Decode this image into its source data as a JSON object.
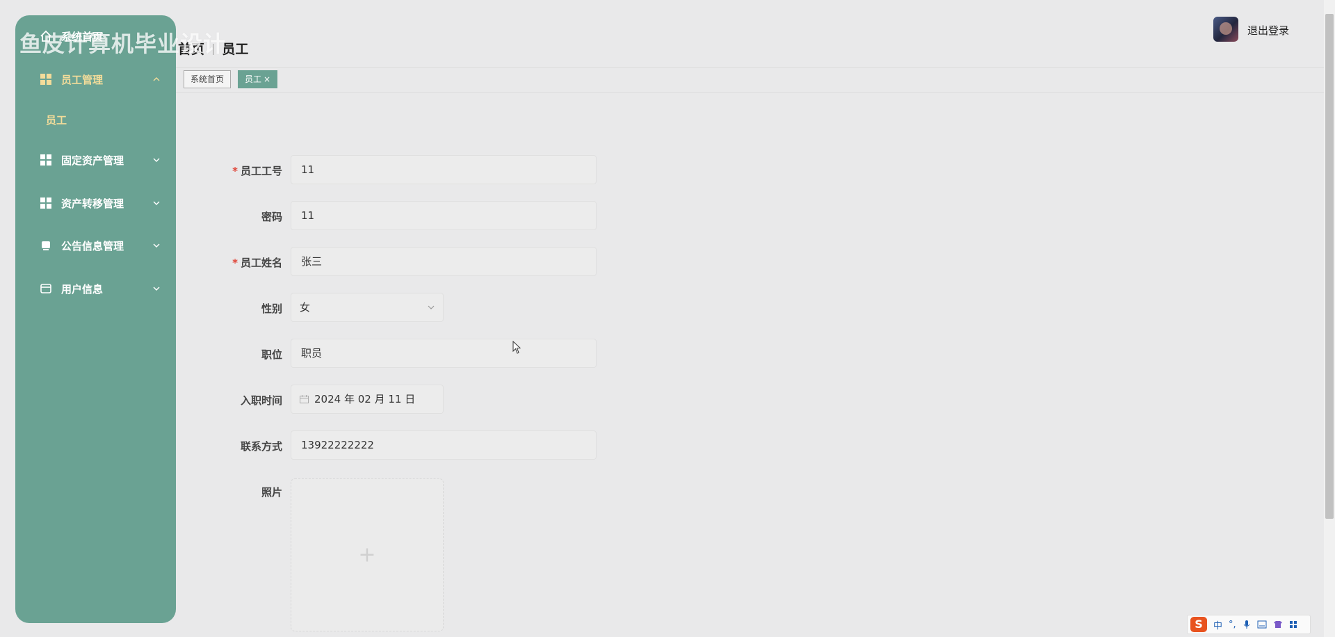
{
  "watermark": "鱼皮计算机毕业设计",
  "sidebar": {
    "home_label": "系统首页",
    "groups": [
      {
        "label": "员工管理",
        "expanded": true,
        "children": [
          "员工"
        ]
      },
      {
        "label": "固定资产管理",
        "expanded": false
      },
      {
        "label": "资产转移管理",
        "expanded": false
      },
      {
        "label": "公告信息管理",
        "expanded": false
      },
      {
        "label": "用户信息",
        "expanded": false
      }
    ]
  },
  "header": {
    "breadcrumb": [
      "首页",
      "员工"
    ],
    "logout_label": "退出登录"
  },
  "tabs": [
    {
      "label": "系统首页",
      "active": false
    },
    {
      "label": "员工",
      "active": true,
      "close": "×"
    }
  ],
  "form": {
    "employee_no": {
      "label": "员工工号",
      "required": true,
      "value": "11"
    },
    "password": {
      "label": "密码",
      "required": false,
      "value": "11"
    },
    "employee_name": {
      "label": "员工姓名",
      "required": true,
      "value": "张三"
    },
    "gender": {
      "label": "性别",
      "required": false,
      "value": "女"
    },
    "position": {
      "label": "职位",
      "required": false,
      "value": "职员"
    },
    "hire_date": {
      "label": "入职时间",
      "required": false,
      "value": "2024 年 02 月 11 日"
    },
    "contact": {
      "label": "联系方式",
      "required": false,
      "value": "13922222222"
    },
    "photo": {
      "label": "照片",
      "upload_plus": "+"
    }
  },
  "required_mark": "*",
  "ime": {
    "logo": "S",
    "lang": "中",
    "punct": "°,"
  },
  "colors": {
    "sidebar": "#6aa293",
    "accent_text": "#f3dc9a",
    "required": "#e0463a"
  }
}
